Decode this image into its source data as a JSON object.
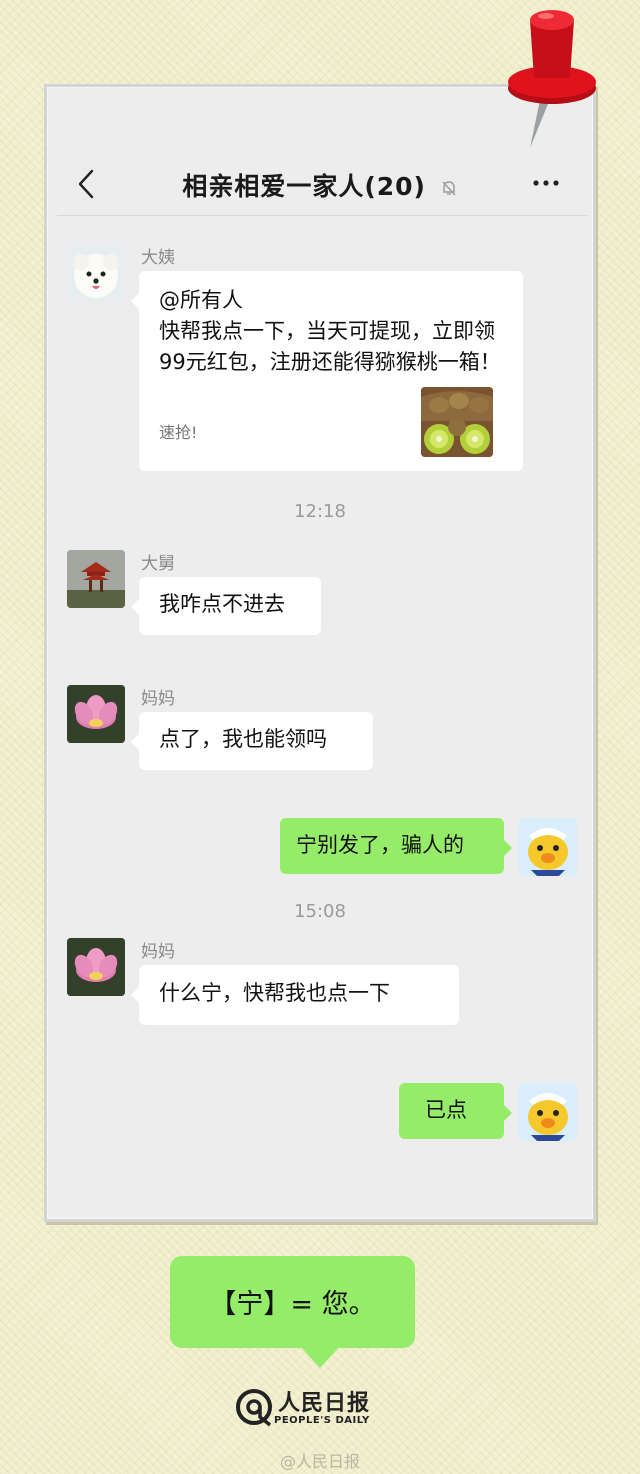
{
  "chat": {
    "title": "相亲相爱一家人(20)",
    "messages": [
      {
        "sender": "大姨",
        "card_text": "@所有人\n快帮我点一下，当天可提现，立即领99元红包，注册还能得猕猴桃一箱！",
        "card_sub": "速抢!"
      },
      {
        "time": "12:18"
      },
      {
        "sender": "大舅",
        "text": "我咋点不进去"
      },
      {
        "sender": "妈妈",
        "text": "点了，我也能领吗"
      },
      {
        "me": true,
        "text": "宁别发了，骗人的"
      },
      {
        "time": "15:08"
      },
      {
        "sender": "妈妈",
        "text": "什么宁，快帮我也点一下"
      },
      {
        "me": true,
        "text": "已点"
      }
    ]
  },
  "tip": {
    "text": "【宁】= 您。"
  },
  "footer": {
    "logo_text": "人民日报",
    "logo_en": "PEOPLE'S DAILY",
    "weibo": "@人民日报"
  },
  "icons": {
    "back": "chevron-left-icon",
    "mute": "bell-off-icon",
    "more": "more-dots-icon",
    "pin": "push-pin-icon"
  },
  "colors": {
    "background": "#f3f1d2",
    "chat_bg": "#ededed",
    "bubble_me": "#95ec69",
    "bubble_other": "#ffffff",
    "pin": "#d7101c"
  }
}
